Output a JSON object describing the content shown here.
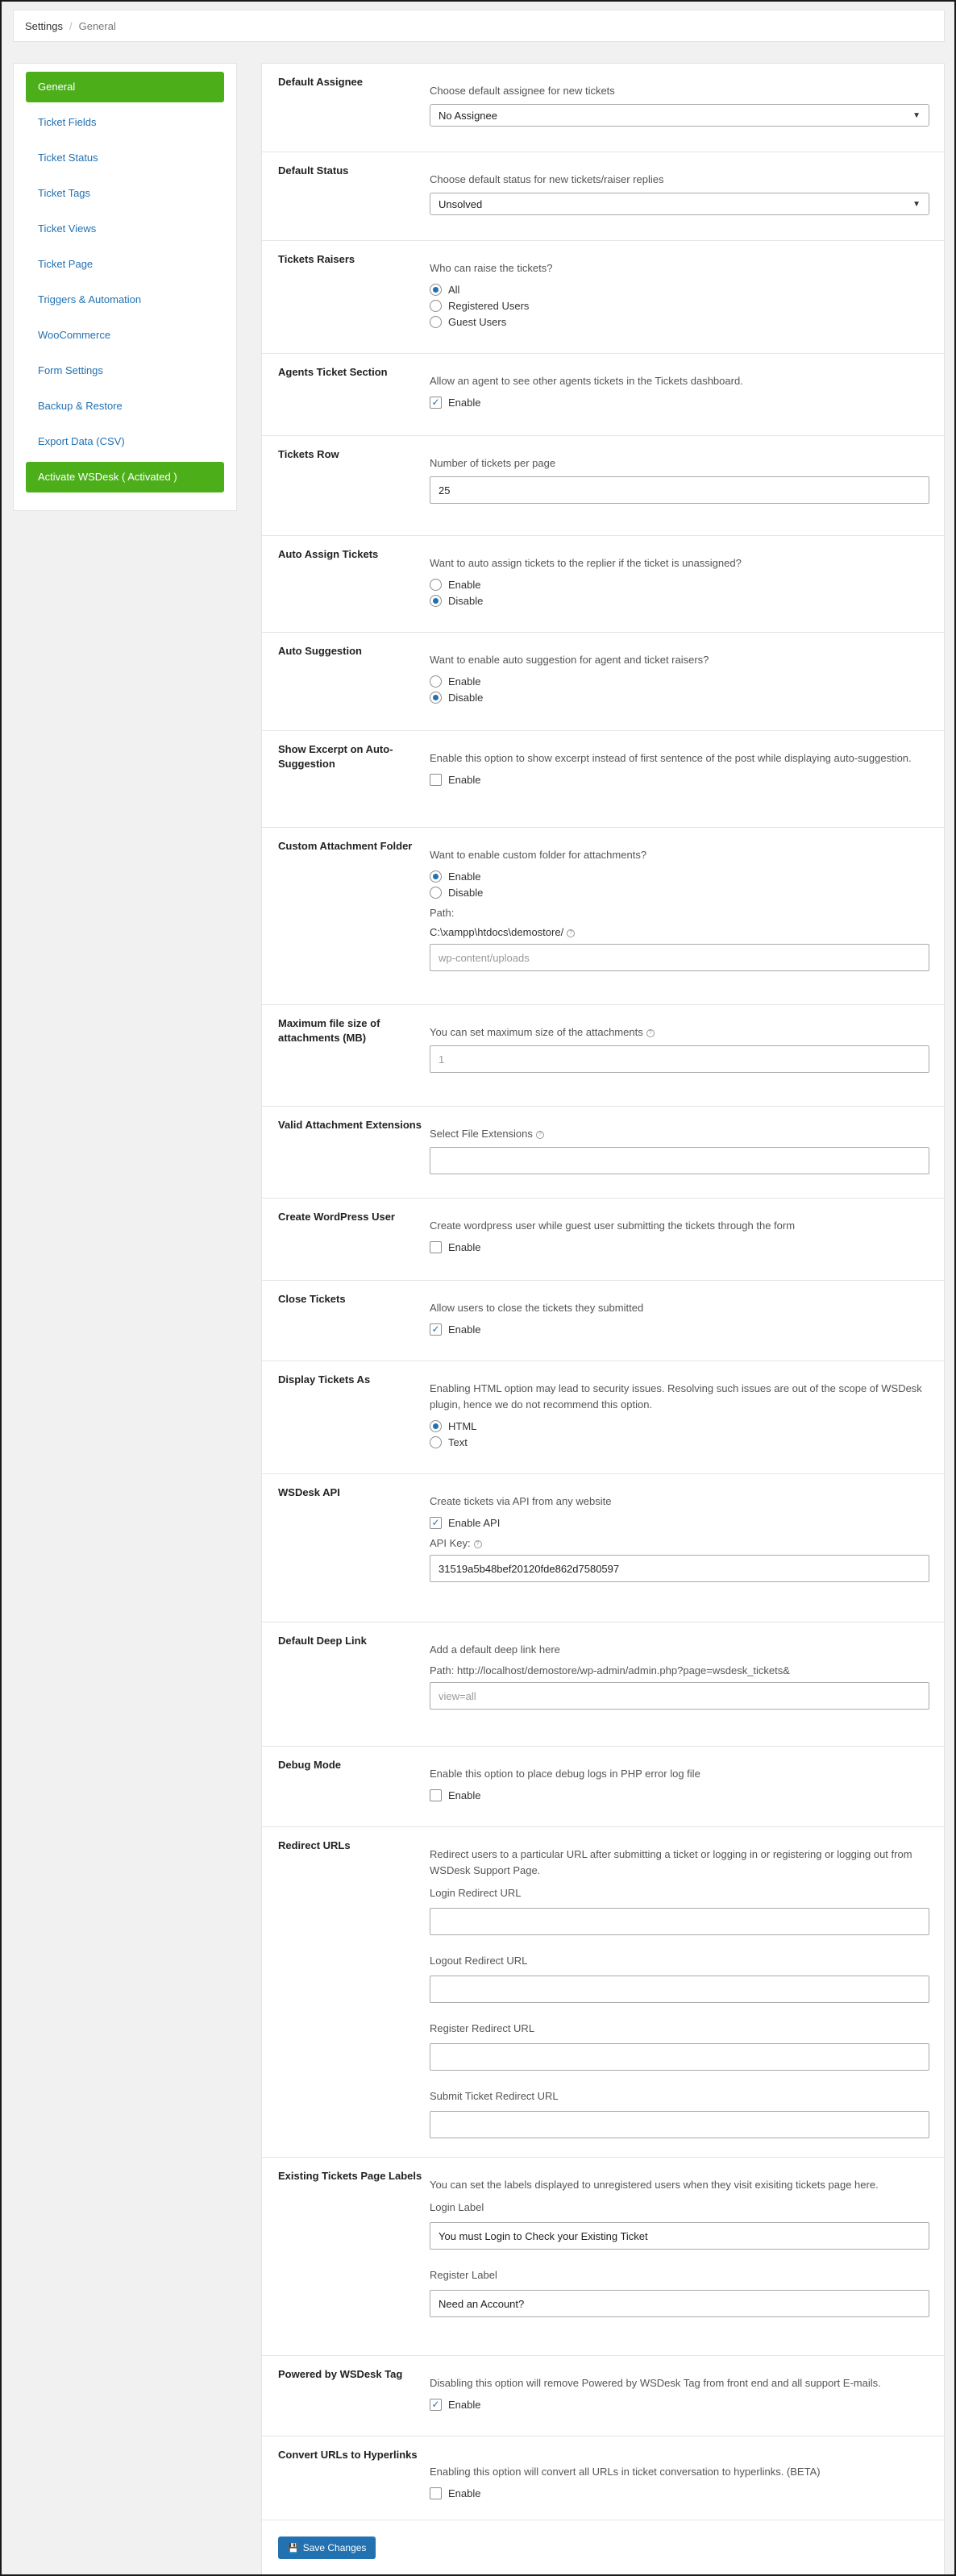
{
  "breadcrumb": {
    "root": "Settings",
    "current": "General"
  },
  "sidebar": {
    "items": [
      {
        "label": "General"
      },
      {
        "label": "Ticket Fields"
      },
      {
        "label": "Ticket Status"
      },
      {
        "label": "Ticket Tags"
      },
      {
        "label": "Ticket Views"
      },
      {
        "label": "Ticket Page"
      },
      {
        "label": "Triggers & Automation"
      },
      {
        "label": "WooCommerce"
      },
      {
        "label": "Form Settings"
      },
      {
        "label": "Backup & Restore"
      },
      {
        "label": "Export Data (CSV)"
      },
      {
        "label": "Activate WSDesk ( Activated )"
      }
    ]
  },
  "settings": {
    "default_assignee": {
      "label": "Default Assignee",
      "desc": "Choose default assignee for new tickets",
      "value": "No Assignee"
    },
    "default_status": {
      "label": "Default Status",
      "desc": "Choose default status for new tickets/raiser replies",
      "value": "Unsolved"
    },
    "tickets_raisers": {
      "label": "Tickets Raisers",
      "desc": "Who can raise the tickets?",
      "opt1": "All",
      "opt2": "Registered Users",
      "opt3": "Guest Users"
    },
    "agents_ticket_section": {
      "label": "Agents Ticket Section",
      "desc": "Allow an agent to see other agents tickets in the Tickets dashboard.",
      "check": "Enable"
    },
    "tickets_row": {
      "label": "Tickets Row",
      "desc": "Number of tickets per page",
      "value": "25"
    },
    "auto_assign": {
      "label": "Auto Assign Tickets",
      "desc": "Want to auto assign tickets to the replier if the ticket is unassigned?",
      "opt1": "Enable",
      "opt2": "Disable"
    },
    "auto_suggestion": {
      "label": "Auto Suggestion",
      "desc": "Want to enable auto suggestion for agent and ticket raisers?",
      "opt1": "Enable",
      "opt2": "Disable"
    },
    "show_excerpt": {
      "label": "Show Excerpt on Auto-Suggestion",
      "desc": "Enable this option to show excerpt instead of first sentence of the post while displaying auto-suggestion.",
      "check": "Enable"
    },
    "custom_attachment": {
      "label": "Custom Attachment Folder",
      "desc": "Want to enable custom folder for attachments?",
      "opt1": "Enable",
      "opt2": "Disable",
      "path_label": "Path:",
      "path_value": "C:\\xampp\\htdocs\\demostore/",
      "placeholder": "wp-content/uploads"
    },
    "max_file_size": {
      "label": "Maximum file size of attachments (MB)",
      "desc": "You can set maximum size of the attachments",
      "placeholder": "1"
    },
    "valid_extensions": {
      "label": "Valid Attachment Extensions",
      "desc": "Select File Extensions",
      "value": ""
    },
    "create_wp_user": {
      "label": "Create WordPress User",
      "desc": "Create wordpress user while guest user submitting the tickets through the form",
      "check": "Enable"
    },
    "close_tickets": {
      "label": "Close Tickets",
      "desc": "Allow users to close the tickets they submitted",
      "check": "Enable"
    },
    "display_tickets_as": {
      "label": "Display Tickets As",
      "desc": "Enabling HTML option may lead to security issues. Resolving such issues are out of the scope of WSDesk plugin, hence we do not recommend this option.",
      "opt1": "HTML",
      "opt2": "Text"
    },
    "wsdesk_api": {
      "label": "WSDesk API",
      "desc": "Create tickets via API from any website",
      "check": "Enable API",
      "key_label": "API Key:",
      "key_value": "31519a5b48bef20120fde862d7580597"
    },
    "deep_link": {
      "label": "Default Deep Link",
      "desc": "Add a default deep link here",
      "path": "Path: http://localhost/demostore/wp-admin/admin.php?page=wsdesk_tickets&",
      "placeholder": "view=all"
    },
    "debug_mode": {
      "label": "Debug Mode",
      "desc": "Enable this option to place debug logs in PHP error log file",
      "check": "Enable"
    },
    "redirect_urls": {
      "label": "Redirect URLs",
      "desc": "Redirect users to a particular URL after submitting a ticket or logging in or registering or logging out from WSDesk Support Page.",
      "login": "Login Redirect URL",
      "logout": "Logout Redirect URL",
      "register": "Register Redirect URL",
      "submit": "Submit Ticket Redirect URL"
    },
    "existing_labels": {
      "label": "Existing Tickets Page Labels",
      "desc": "You can set the labels displayed to unregistered users when they visit exisiting tickets page here.",
      "login_label": "Login Label",
      "login_value": "You must Login to Check your Existing Ticket",
      "register_label": "Register Label",
      "register_value": "Need an Account?"
    },
    "powered_by": {
      "label": "Powered by WSDesk Tag",
      "desc": "Disabling this option will remove Powered by WSDesk Tag from front end and all support E-mails.",
      "check": "Enable"
    },
    "convert_urls": {
      "label": "Convert URLs to Hyperlinks",
      "desc": "Enabling this option will convert all URLs in ticket conversation to hyperlinks. (BETA)",
      "check": "Enable"
    }
  },
  "save_label": "Save Changes",
  "colors": {
    "accent": "#4caf1a",
    "link": "#2271b1"
  }
}
